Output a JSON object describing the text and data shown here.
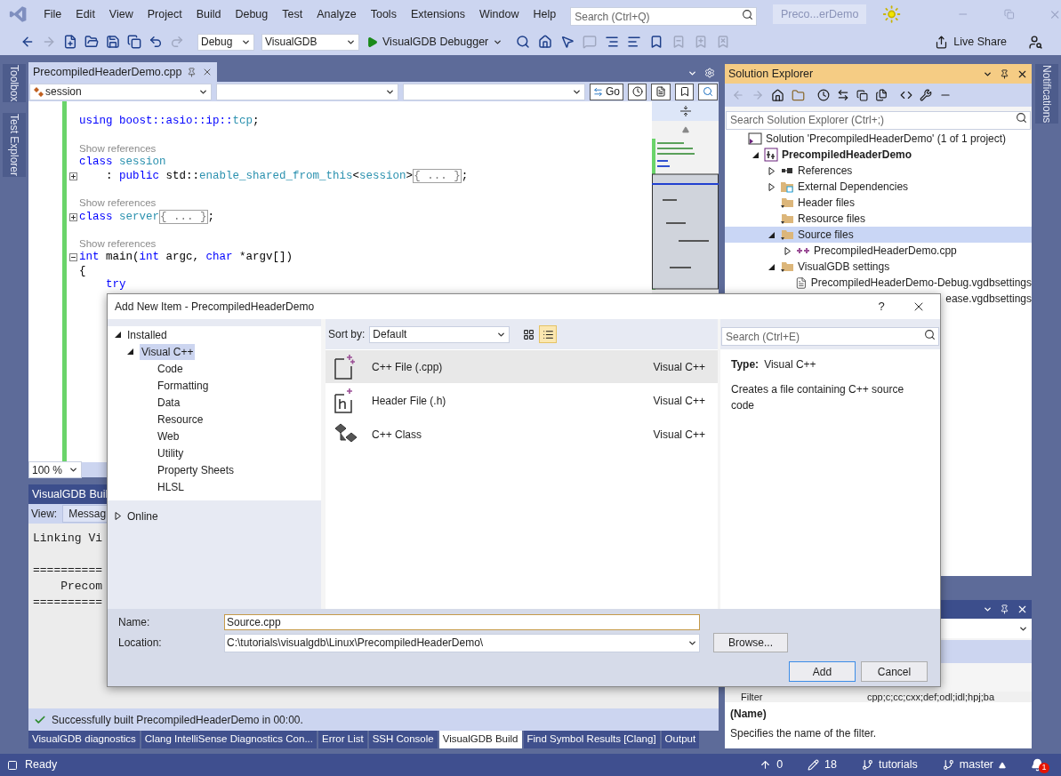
{
  "menu_bar": {
    "items": [
      "File",
      "Edit",
      "View",
      "Project",
      "Build",
      "Debug",
      "Test",
      "Analyze",
      "Tools",
      "Extensions",
      "Window",
      "Help"
    ],
    "search": {
      "placeholder": "Search (Ctrl+Q)"
    },
    "solution_name": "Preco...erDemo"
  },
  "toolbar": {
    "left_buttons": [
      {
        "kind": "back",
        "disabled": false
      },
      {
        "kind": "forward",
        "disabled": true
      },
      {
        "kind": "new",
        "disabled": false
      },
      {
        "kind": "open",
        "disabled": false
      },
      {
        "kind": "save",
        "disabled": false
      },
      {
        "kind": "saveall",
        "disabled": false
      },
      {
        "kind": "undo",
        "disabled": false
      },
      {
        "kind": "redo",
        "disabled": true
      }
    ],
    "configuration": "Debug",
    "platform": "VisualGDB",
    "start_button": "VisualGDB Debugger",
    "right_buttons": [
      {
        "kind": "find",
        "disabled": false
      },
      {
        "kind": "home",
        "disabled": false
      },
      {
        "kind": "select",
        "disabled": false
      },
      {
        "kind": "comment",
        "disabled": true
      },
      {
        "kind": "indent",
        "disabled": false
      },
      {
        "kind": "outdent",
        "disabled": false
      },
      {
        "kind": "bookmark",
        "disabled": false
      },
      {
        "kind": "prevbookmark",
        "disabled": true
      },
      {
        "kind": "nextbookmark",
        "disabled": true
      },
      {
        "kind": "clearbookmark",
        "disabled": true
      }
    ],
    "live_share": "Live Share"
  },
  "side_tabs_left": [
    "Toolbox",
    "Test Explorer"
  ],
  "side_tabs_right": [
    "Notifications"
  ],
  "editor": {
    "tab_title": "PrecompiledHeaderDemo.cpp",
    "nav_scope": "session",
    "go_button": "Go",
    "zoom": "100 %",
    "lines": [
      {
        "kind": "blank"
      },
      {
        "kind": "code",
        "tokens": [
          {
            "text": "using boost::asio::ip::",
            "kind": "kw_plain"
          },
          {
            "text": "tcp",
            "kind": "type"
          },
          {
            "text": ";",
            "kind": "plain"
          }
        ]
      },
      {
        "kind": "blank"
      },
      {
        "kind": "refs",
        "text": "Show references"
      },
      {
        "kind": "code",
        "tokens": [
          {
            "text": "class ",
            "kind": "kw"
          },
          {
            "text": "session",
            "kind": "type"
          }
        ]
      },
      {
        "kind": "code",
        "collapsed": true,
        "tokens": [
          {
            "text": "    : ",
            "kind": "plain"
          },
          {
            "text": "public ",
            "kind": "kw"
          },
          {
            "text": "std::",
            "kind": "plain"
          },
          {
            "text": "enable_shared_from_this",
            "kind": "type"
          },
          {
            "text": "<",
            "kind": "plain"
          },
          {
            "text": "session",
            "kind": "type"
          },
          {
            "text": ">",
            "kind": "plain"
          },
          {
            "text": "{ ... }",
            "kind": "folded"
          },
          {
            "text": ";",
            "kind": "plain"
          }
        ]
      },
      {
        "kind": "blank"
      },
      {
        "kind": "refs",
        "text": "Show references"
      },
      {
        "kind": "code",
        "collapsed": true,
        "tokens": [
          {
            "text": "class ",
            "kind": "kw"
          },
          {
            "text": "server",
            "kind": "type"
          },
          {
            "text": "{ ... }",
            "kind": "folded"
          },
          {
            "text": ";",
            "kind": "plain"
          }
        ]
      },
      {
        "kind": "blank"
      },
      {
        "kind": "refs",
        "text": "Show references"
      },
      {
        "kind": "code",
        "collapsed": false,
        "tokens": [
          {
            "text": "int ",
            "kind": "kw"
          },
          {
            "text": "main(",
            "kind": "plain"
          },
          {
            "text": "int ",
            "kind": "kw"
          },
          {
            "text": "argc, ",
            "kind": "plain"
          },
          {
            "text": "char ",
            "kind": "kw"
          },
          {
            "text": "*argv[])",
            "kind": "plain"
          }
        ]
      },
      {
        "kind": "code",
        "tokens": [
          {
            "text": "{",
            "kind": "plain"
          }
        ]
      },
      {
        "kind": "code",
        "tokens": [
          {
            "text": "    try",
            "kind": "kw"
          }
        ]
      }
    ]
  },
  "output": {
    "title": "VisualGDB Buil",
    "view_label": "View:",
    "view_value": "Messag",
    "lines": [
      "Linking Vi",
      "==========",
      "    Precom",
      "=========="
    ],
    "status": "Successfully built PrecompiledHeaderDemo in 00:00.",
    "tabs": [
      {
        "label": "VisualGDB diagnostics",
        "selected": false
      },
      {
        "label": "Clang IntelliSense Diagnostics Con...",
        "selected": false
      },
      {
        "label": "Error List",
        "selected": false
      },
      {
        "label": "SSH Console",
        "selected": false
      },
      {
        "label": "VisualGDB Build",
        "selected": true
      },
      {
        "label": "Find Symbol Results [Clang]",
        "selected": false
      },
      {
        "label": "Output",
        "selected": false
      }
    ]
  },
  "solution_explorer": {
    "title": "Solution Explorer",
    "search": {
      "placeholder": "Search Solution Explorer (Ctrl+;)"
    },
    "tree": [
      {
        "label": "Solution 'PrecompiledHeaderDemo' (1 of 1 project)",
        "kind": "solution",
        "selected": false,
        "children": [
          {
            "label": "PrecompiledHeaderDemo",
            "kind": "project",
            "expanded": true,
            "selected": false,
            "children": [
              {
                "label": "References",
                "kind": "references",
                "expanded": false,
                "selected": false
              },
              {
                "label": "External Dependencies",
                "kind": "external",
                "expanded": false,
                "selected": false
              },
              {
                "label": "Header files",
                "kind": "filter",
                "selected": false
              },
              {
                "label": "Resource files",
                "kind": "filter",
                "selected": false
              },
              {
                "label": "Source files",
                "kind": "filter",
                "expanded": true,
                "selected": true,
                "children": [
                  {
                    "label": "PrecompiledHeaderDemo.cpp",
                    "kind": "cpp",
                    "expanded": false,
                    "selected": false
                  }
                ]
              },
              {
                "label": "VisualGDB settings",
                "kind": "filter",
                "expanded": true,
                "selected": false,
                "children": [
                  {
                    "label": "PrecompiledHeaderDemo-Debug.vgdbsettings",
                    "kind": "file",
                    "selected": false
                  },
                  {
                    "label": "ease.vgdbsettings",
                    "kind": "file",
                    "selected": false,
                    "clipped": true
                  }
                ]
              }
            ]
          }
        ]
      }
    ]
  },
  "properties": {
    "rows": [
      {
        "name": "Filter",
        "value": "cpp;c;cc;cxx;def;odl;idl;hpj;ba"
      }
    ],
    "description_title": "(Name)",
    "description": "Specifies the name of the filter."
  },
  "dialog": {
    "title": "Add New Item - PrecompiledHeaderDemo",
    "help": "?",
    "categories": [
      {
        "label": "Installed",
        "expanded": true,
        "children": [
          {
            "label": "Visual C++",
            "expanded": true,
            "selected": true,
            "children": [
              {
                "label": "Code",
                "selected": false
              },
              {
                "label": "Formatting",
                "selected": false
              },
              {
                "label": "Data",
                "selected": false
              },
              {
                "label": "Resource",
                "selected": false
              },
              {
                "label": "Web",
                "selected": false
              },
              {
                "label": "Utility",
                "selected": false
              },
              {
                "label": "Property Sheets",
                "selected": false
              },
              {
                "label": "HLSL",
                "selected": false
              }
            ]
          }
        ]
      },
      {
        "label": "Online",
        "expanded": false
      }
    ],
    "sort_label": "Sort by:",
    "sort_value": "Default",
    "view_buttons": [
      {
        "kind": "grid",
        "selected": false
      },
      {
        "kind": "list",
        "selected": true
      }
    ],
    "search": {
      "placeholder": "Search (Ctrl+E)"
    },
    "templates": [
      {
        "name": "C++ File (.cpp)",
        "language": "Visual C++",
        "kind": "cpp",
        "selected": true
      },
      {
        "name": "Header File (.h)",
        "language": "Visual C++",
        "kind": "header",
        "selected": false
      },
      {
        "name": "C++ Class",
        "language": "Visual C++",
        "kind": "class",
        "selected": false
      }
    ],
    "type_label": "Type:",
    "type_value": "Visual C++",
    "description": "Creates a file containing C++ source code",
    "name_label": "Name:",
    "name_value": "Source.cpp",
    "location_label": "Location:",
    "location_value": "C:\\tutorials\\visualgdb\\Linux\\PrecompiledHeaderDemo\\",
    "browse_button": "Browse...",
    "add_button": "Add",
    "cancel_button": "Cancel"
  },
  "status_bar": {
    "text": "Ready",
    "pushes": "0",
    "changes": "18",
    "repository": "tutorials",
    "branch": "master",
    "notifications": "1"
  }
}
